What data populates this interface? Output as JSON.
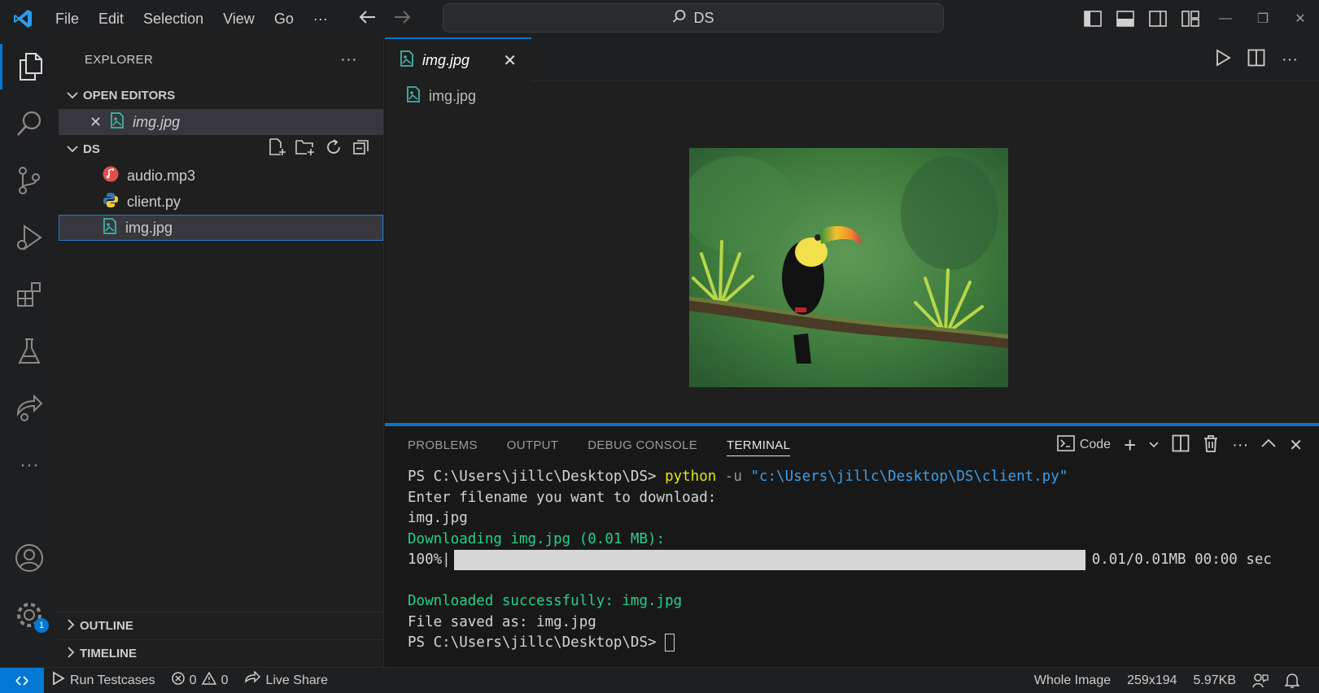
{
  "titlebar": {
    "menu": [
      "File",
      "Edit",
      "Selection",
      "View",
      "Go",
      "···"
    ],
    "search_text": "DS"
  },
  "sidebar": {
    "title": "EXPLORER",
    "more": "···",
    "open_editors_label": "OPEN EDITORS",
    "open_editor_file": "img.jpg",
    "folder_label": "DS",
    "files": [
      {
        "name": "audio.mp3",
        "icon": "audio-file-icon"
      },
      {
        "name": "client.py",
        "icon": "python-file-icon"
      },
      {
        "name": "img.jpg",
        "icon": "image-file-icon",
        "selected": true
      }
    ],
    "outline_label": "OUTLINE",
    "timeline_label": "TIMELINE"
  },
  "editor": {
    "tab_label": "img.jpg",
    "tab_close": "✕",
    "breadcrumb": "img.jpg",
    "preview_alt": "toucan on branch"
  },
  "panel": {
    "tabs": [
      "PROBLEMS",
      "OUTPUT",
      "DEBUG CONSOLE",
      "TERMINAL"
    ],
    "active_tab": "TERMINAL",
    "shell_label": "Code",
    "terminal": {
      "prompt": "PS C:\\Users\\jillc\\Desktop\\DS> ",
      "cmd": "python",
      "flag": " -u ",
      "path_arg": "\"c:\\Users\\jillc\\Desktop\\DS\\client.py\"",
      "line2": "Enter filename you want to download:",
      "line3": "img.jpg",
      "line4": "Downloading img.jpg (0.01 MB):",
      "progress_label": "100%|",
      "progress_fraction": 1.0,
      "progress_stats": "0.01/0.01MB 00:00 sec",
      "line6": "Downloaded successfully: img.jpg",
      "line7": "File saved as: img.jpg",
      "prompt_final": "PS C:\\Users\\jillc\\Desktop\\DS> "
    }
  },
  "statusbar": {
    "run_testcases": "Run Testcases",
    "errors": "0",
    "warnings": "0",
    "live_share": "Live Share",
    "whole_image": "Whole Image",
    "dimensions": "259x194",
    "size": "5.97KB"
  },
  "badges": {
    "settings_count": "1"
  },
  "colors": {
    "accent": "#0078d4",
    "terminal_green": "#23d18b",
    "terminal_yellow": "#e5e510",
    "terminal_blue": "#3b9fe8"
  }
}
